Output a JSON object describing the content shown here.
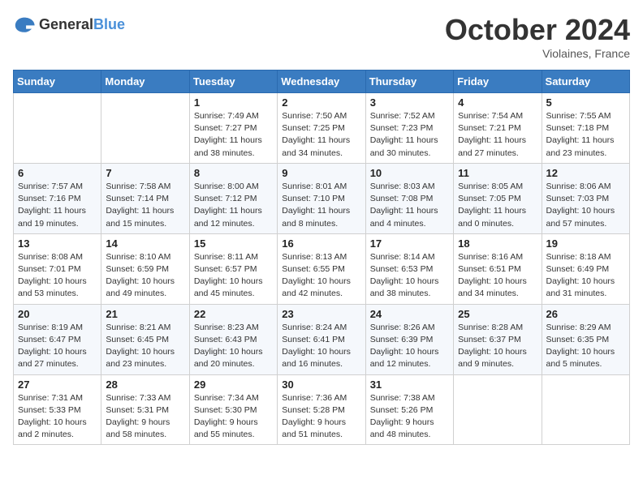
{
  "logo": {
    "general": "General",
    "blue": "Blue"
  },
  "title": "October 2024",
  "subtitle": "Violaines, France",
  "days_of_week": [
    "Sunday",
    "Monday",
    "Tuesday",
    "Wednesday",
    "Thursday",
    "Friday",
    "Saturday"
  ],
  "weeks": [
    [
      {
        "day": "",
        "info": ""
      },
      {
        "day": "",
        "info": ""
      },
      {
        "day": "1",
        "info": "Sunrise: 7:49 AM\nSunset: 7:27 PM\nDaylight: 11 hours and 38 minutes."
      },
      {
        "day": "2",
        "info": "Sunrise: 7:50 AM\nSunset: 7:25 PM\nDaylight: 11 hours and 34 minutes."
      },
      {
        "day": "3",
        "info": "Sunrise: 7:52 AM\nSunset: 7:23 PM\nDaylight: 11 hours and 30 minutes."
      },
      {
        "day": "4",
        "info": "Sunrise: 7:54 AM\nSunset: 7:21 PM\nDaylight: 11 hours and 27 minutes."
      },
      {
        "day": "5",
        "info": "Sunrise: 7:55 AM\nSunset: 7:18 PM\nDaylight: 11 hours and 23 minutes."
      }
    ],
    [
      {
        "day": "6",
        "info": "Sunrise: 7:57 AM\nSunset: 7:16 PM\nDaylight: 11 hours and 19 minutes."
      },
      {
        "day": "7",
        "info": "Sunrise: 7:58 AM\nSunset: 7:14 PM\nDaylight: 11 hours and 15 minutes."
      },
      {
        "day": "8",
        "info": "Sunrise: 8:00 AM\nSunset: 7:12 PM\nDaylight: 11 hours and 12 minutes."
      },
      {
        "day": "9",
        "info": "Sunrise: 8:01 AM\nSunset: 7:10 PM\nDaylight: 11 hours and 8 minutes."
      },
      {
        "day": "10",
        "info": "Sunrise: 8:03 AM\nSunset: 7:08 PM\nDaylight: 11 hours and 4 minutes."
      },
      {
        "day": "11",
        "info": "Sunrise: 8:05 AM\nSunset: 7:05 PM\nDaylight: 11 hours and 0 minutes."
      },
      {
        "day": "12",
        "info": "Sunrise: 8:06 AM\nSunset: 7:03 PM\nDaylight: 10 hours and 57 minutes."
      }
    ],
    [
      {
        "day": "13",
        "info": "Sunrise: 8:08 AM\nSunset: 7:01 PM\nDaylight: 10 hours and 53 minutes."
      },
      {
        "day": "14",
        "info": "Sunrise: 8:10 AM\nSunset: 6:59 PM\nDaylight: 10 hours and 49 minutes."
      },
      {
        "day": "15",
        "info": "Sunrise: 8:11 AM\nSunset: 6:57 PM\nDaylight: 10 hours and 45 minutes."
      },
      {
        "day": "16",
        "info": "Sunrise: 8:13 AM\nSunset: 6:55 PM\nDaylight: 10 hours and 42 minutes."
      },
      {
        "day": "17",
        "info": "Sunrise: 8:14 AM\nSunset: 6:53 PM\nDaylight: 10 hours and 38 minutes."
      },
      {
        "day": "18",
        "info": "Sunrise: 8:16 AM\nSunset: 6:51 PM\nDaylight: 10 hours and 34 minutes."
      },
      {
        "day": "19",
        "info": "Sunrise: 8:18 AM\nSunset: 6:49 PM\nDaylight: 10 hours and 31 minutes."
      }
    ],
    [
      {
        "day": "20",
        "info": "Sunrise: 8:19 AM\nSunset: 6:47 PM\nDaylight: 10 hours and 27 minutes."
      },
      {
        "day": "21",
        "info": "Sunrise: 8:21 AM\nSunset: 6:45 PM\nDaylight: 10 hours and 23 minutes."
      },
      {
        "day": "22",
        "info": "Sunrise: 8:23 AM\nSunset: 6:43 PM\nDaylight: 10 hours and 20 minutes."
      },
      {
        "day": "23",
        "info": "Sunrise: 8:24 AM\nSunset: 6:41 PM\nDaylight: 10 hours and 16 minutes."
      },
      {
        "day": "24",
        "info": "Sunrise: 8:26 AM\nSunset: 6:39 PM\nDaylight: 10 hours and 12 minutes."
      },
      {
        "day": "25",
        "info": "Sunrise: 8:28 AM\nSunset: 6:37 PM\nDaylight: 10 hours and 9 minutes."
      },
      {
        "day": "26",
        "info": "Sunrise: 8:29 AM\nSunset: 6:35 PM\nDaylight: 10 hours and 5 minutes."
      }
    ],
    [
      {
        "day": "27",
        "info": "Sunrise: 7:31 AM\nSunset: 5:33 PM\nDaylight: 10 hours and 2 minutes."
      },
      {
        "day": "28",
        "info": "Sunrise: 7:33 AM\nSunset: 5:31 PM\nDaylight: 9 hours and 58 minutes."
      },
      {
        "day": "29",
        "info": "Sunrise: 7:34 AM\nSunset: 5:30 PM\nDaylight: 9 hours and 55 minutes."
      },
      {
        "day": "30",
        "info": "Sunrise: 7:36 AM\nSunset: 5:28 PM\nDaylight: 9 hours and 51 minutes."
      },
      {
        "day": "31",
        "info": "Sunrise: 7:38 AM\nSunset: 5:26 PM\nDaylight: 9 hours and 48 minutes."
      },
      {
        "day": "",
        "info": ""
      },
      {
        "day": "",
        "info": ""
      }
    ]
  ]
}
